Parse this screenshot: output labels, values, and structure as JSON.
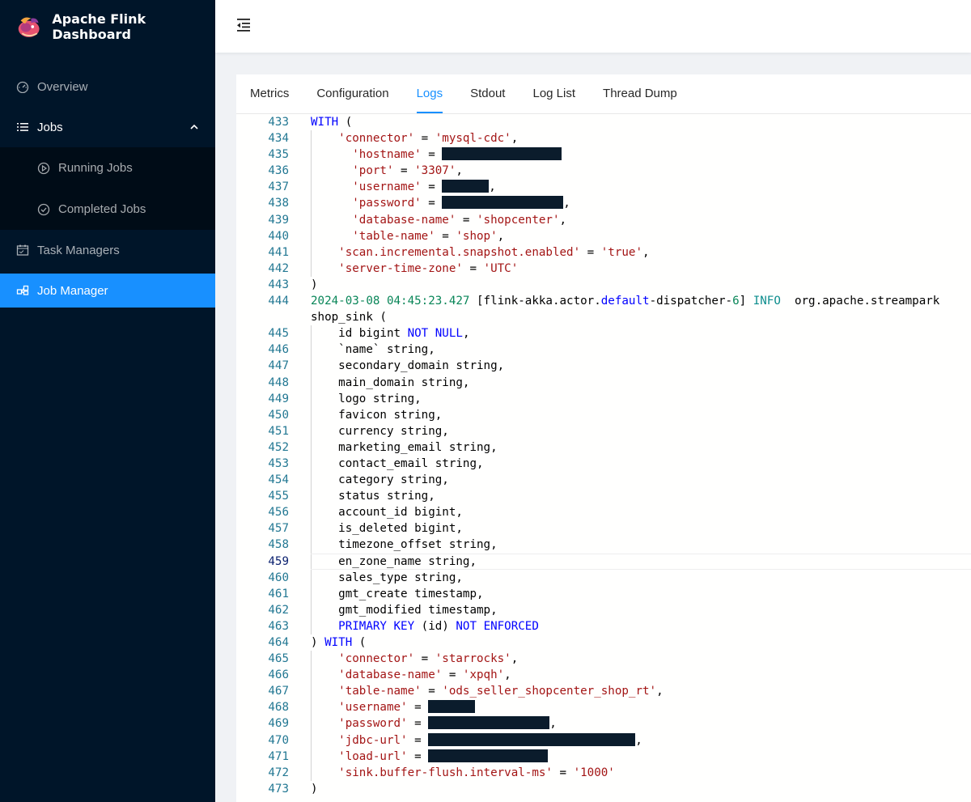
{
  "app": {
    "title": "Apache Flink Dashboard"
  },
  "sidebar": {
    "items": [
      {
        "label": "Overview",
        "icon": "dashboard-icon"
      },
      {
        "label": "Jobs",
        "icon": "list-icon",
        "expanded": true,
        "children": [
          {
            "label": "Running Jobs",
            "icon": "play-circle-icon"
          },
          {
            "label": "Completed Jobs",
            "icon": "check-circle-icon"
          }
        ]
      },
      {
        "label": "Task Managers",
        "icon": "schedule-icon"
      },
      {
        "label": "Job Manager",
        "icon": "cluster-icon",
        "selected": true
      }
    ]
  },
  "tabs": [
    {
      "label": "Metrics"
    },
    {
      "label": "Configuration"
    },
    {
      "label": "Logs",
      "active": true
    },
    {
      "label": "Stdout"
    },
    {
      "label": "Log List"
    },
    {
      "label": "Thread Dump"
    }
  ],
  "editor": {
    "current_line": 459,
    "lines": [
      {
        "n": "433",
        "text": "WITH ("
      },
      {
        "n": "434",
        "text": "    'connector' = 'mysql-cdc',"
      },
      {
        "n": "435",
        "text": "      'hostname' = [REDACTED]"
      },
      {
        "n": "436",
        "text": "      'port' = '3307',"
      },
      {
        "n": "437",
        "text": "      'username' = [REDACTED],"
      },
      {
        "n": "438",
        "text": "      'password' = [REDACTED],"
      },
      {
        "n": "439",
        "text": "      'database-name' = 'shopcenter',"
      },
      {
        "n": "440",
        "text": "      'table-name' = 'shop',"
      },
      {
        "n": "441",
        "text": "    'scan.incremental.snapshot.enabled' = 'true',"
      },
      {
        "n": "442",
        "text": "    'server-time-zone' = 'UTC'"
      },
      {
        "n": "443",
        "text": ")"
      },
      {
        "n": "444",
        "text": "2024-03-08 04:45:23.427 [flink-akka.actor.default-dispatcher-6] INFO  org.apache.streampark"
      },
      {
        "n": "",
        "text": "shop_sink ("
      },
      {
        "n": "445",
        "text": "    id bigint NOT NULL,"
      },
      {
        "n": "446",
        "text": "    `name` string,"
      },
      {
        "n": "447",
        "text": "    secondary_domain string,"
      },
      {
        "n": "448",
        "text": "    main_domain string,"
      },
      {
        "n": "449",
        "text": "    logo string,"
      },
      {
        "n": "450",
        "text": "    favicon string,"
      },
      {
        "n": "451",
        "text": "    currency string,"
      },
      {
        "n": "452",
        "text": "    marketing_email string,"
      },
      {
        "n": "453",
        "text": "    contact_email string,"
      },
      {
        "n": "454",
        "text": "    category string,"
      },
      {
        "n": "455",
        "text": "    status string,"
      },
      {
        "n": "456",
        "text": "    account_id bigint,"
      },
      {
        "n": "457",
        "text": "    is_deleted bigint,"
      },
      {
        "n": "458",
        "text": "    timezone_offset string,"
      },
      {
        "n": "459",
        "text": "    en_zone_name string,"
      },
      {
        "n": "460",
        "text": "    sales_type string,"
      },
      {
        "n": "461",
        "text": "    gmt_create timestamp,"
      },
      {
        "n": "462",
        "text": "    gmt_modified timestamp,"
      },
      {
        "n": "463",
        "text": "    PRIMARY KEY (id) NOT ENFORCED"
      },
      {
        "n": "464",
        "text": ") WITH ("
      },
      {
        "n": "465",
        "text": "    'connector' = 'starrocks',"
      },
      {
        "n": "466",
        "text": "    'database-name' = 'xpqh',"
      },
      {
        "n": "467",
        "text": "    'table-name' = 'ods_seller_shopcenter_shop_rt',"
      },
      {
        "n": "468",
        "text": "    'username' = [REDACTED]"
      },
      {
        "n": "469",
        "text": "    'password' = [REDACTED],"
      },
      {
        "n": "470",
        "text": "    'jdbc-url' = [REDACTED],"
      },
      {
        "n": "471",
        "text": "    'load-url' = [REDACTED]"
      },
      {
        "n": "472",
        "text": "    'sink.buffer-flush.interval-ms' = '1000'"
      },
      {
        "n": "473",
        "text": ")"
      }
    ]
  }
}
